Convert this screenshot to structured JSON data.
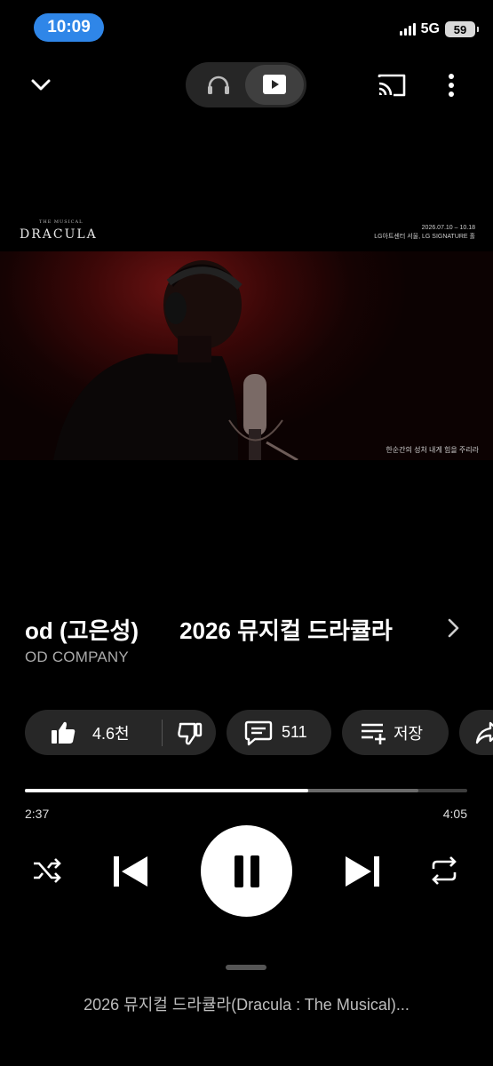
{
  "status": {
    "time": "10:09",
    "network": "5G",
    "battery": "59"
  },
  "video": {
    "logo_small": "THE MUSICAL",
    "logo": "DRACULA",
    "date_line1": "2026.07.10 – 10.18",
    "date_line2": "LG아트센터 서울, LG SIGNATURE 홀",
    "subtitle": "한순간의 성처 내게 힘을 주리라"
  },
  "title": {
    "part1": "od (고은성)",
    "part2": "2026 뮤지컬 드라큘라"
  },
  "channel": "OD COMPANY",
  "actions": {
    "likes": "4.6천",
    "comments": "511",
    "save": "저장"
  },
  "player": {
    "elapsed": "2:37",
    "duration": "4:05",
    "progress": 0.64,
    "buffered": 0.889
  },
  "up_next": "2026 뮤지컬 드라큘라(Dracula : The Musical)..."
}
